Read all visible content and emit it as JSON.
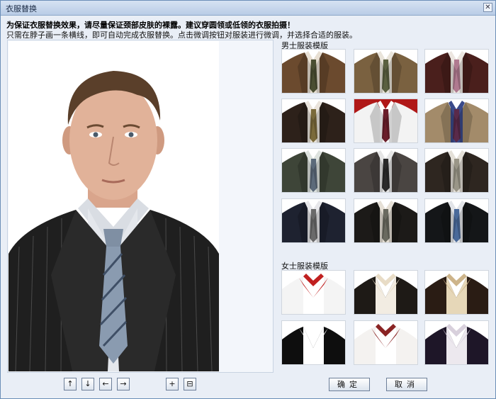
{
  "window": {
    "title": "衣服替换",
    "close_glyph": "✕"
  },
  "notice": {
    "bold": "为保证衣服替换效果，请尽量保证颈部皮肤的裸露。建议穿圆领或低领的衣服拍摄！",
    "detail": "只需在脖子画一条横线，即可自动完成衣服替换。点击微调按钮对服装进行微调，并选择合适的服装。"
  },
  "sections": {
    "male": {
      "label": "男士服装模版",
      "templates": [
        {
          "name": "brown-suit-striped-tie",
          "jacket": "#6b4a2e",
          "shirt": "#e8dfd2",
          "tie": "#4a4e32"
        },
        {
          "name": "tan-suit-olive-tie",
          "jacket": "#7a6140",
          "shirt": "#e9e4da",
          "tie": "#5a6040"
        },
        {
          "name": "maroon-suit-pink-tie",
          "jacket": "#4a1f1c",
          "shirt": "#ece6e0",
          "tie": "#b07a90"
        },
        {
          "name": "dark-brown-suit-gold-tie",
          "jacket": "#2d211a",
          "shirt": "#eae4dc",
          "tie": "#7a6a3a"
        },
        {
          "name": "white-shirt-red-tie",
          "jacket": "#f3f3f3",
          "shirt": "#ffffff",
          "tie": "#6a1e2a",
          "bg": "#b01818"
        },
        {
          "name": "beige-suit-blue-shirt",
          "jacket": "#a38b6a",
          "shirt": "#3a4a8a",
          "tie": "#5a2a4a"
        },
        {
          "name": "grey-green-suit",
          "jacket": "#3e4538",
          "shirt": "#dde2de",
          "tie": "#5c6a7a"
        },
        {
          "name": "charcoal-tweed-suit",
          "jacket": "#4a4542",
          "shirt": "#e6e6e6",
          "tie": "#2a2a2a"
        },
        {
          "name": "dark-brown-suit-silver-tie",
          "jacket": "#2e2620",
          "shirt": "#e4e0d8",
          "tie": "#9a9688"
        },
        {
          "name": "navy-suit-check-tie",
          "jacket": "#1e2230",
          "shirt": "#e7e7ea",
          "tie": "#6a6a6a"
        },
        {
          "name": "black-suit-grey-tie",
          "jacket": "#1c1a18",
          "shirt": "#e6e0d6",
          "tie": "#6a6a60"
        },
        {
          "name": "black-suit-blue-tie",
          "jacket": "#141618",
          "shirt": "#e2e4e8",
          "tie": "#4a6a9a"
        }
      ]
    },
    "female": {
      "label": "女士服装模版",
      "templates": [
        {
          "name": "red-collar-blouse",
          "jacket": "#f4f4f4",
          "shirt": "#ffffff",
          "collar": "#c02020"
        },
        {
          "name": "cream-collar-black-jacket",
          "jacket": "#1e1a16",
          "shirt": "#f2ece2",
          "collar": "#e8dcc6"
        },
        {
          "name": "ruffle-brown-jacket",
          "jacket": "#2a1c14",
          "shirt": "#e6d7b8",
          "collar": "#cdb48a"
        },
        {
          "name": "white-collar-black-jacket",
          "jacket": "#0e0e0e",
          "shirt": "#ffffff",
          "collar": "#ffffff"
        },
        {
          "name": "floral-scarf-blouse",
          "jacket": "#f4f2f0",
          "shirt": "#ffffff",
          "collar": "#8a2424"
        },
        {
          "name": "purple-dark-suit",
          "jacket": "#1e1628",
          "shirt": "#ece8ee",
          "collar": "#d8d0dc"
        }
      ]
    }
  },
  "controls": {
    "up": "↑",
    "down": "↓",
    "left": "←",
    "right": "→",
    "zoom_in": "+",
    "fit": "⊟",
    "confirm": "确定",
    "cancel": "取消"
  }
}
